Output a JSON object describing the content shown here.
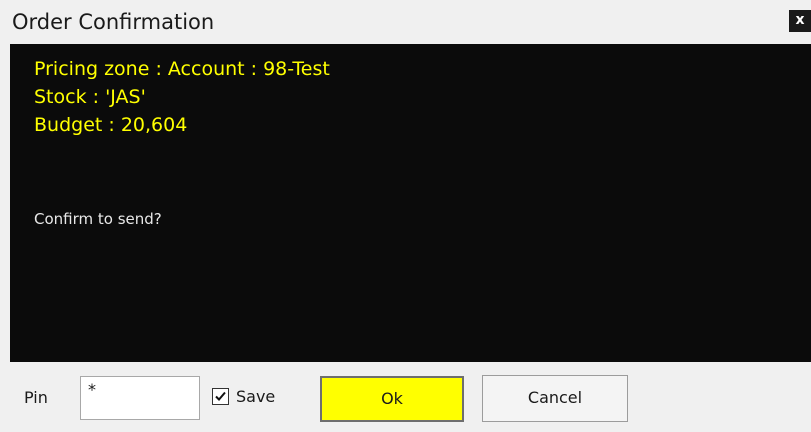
{
  "window": {
    "title": "Order Confirmation",
    "close_label": "x"
  },
  "message": {
    "lines": [
      "Pricing zone : Account : 98-Test",
      "Stock : 'JAS'",
      "Budget : 20,604"
    ],
    "confirm_text": "Confirm to send?",
    "text_color": "#ffff00",
    "background": "#0b0b0b"
  },
  "footer": {
    "pin_label": "Pin",
    "pin_value": "*",
    "save_label": "Save",
    "save_checked": true,
    "ok_label": "Ok",
    "cancel_label": "Cancel",
    "ok_color": "#ffff00"
  }
}
